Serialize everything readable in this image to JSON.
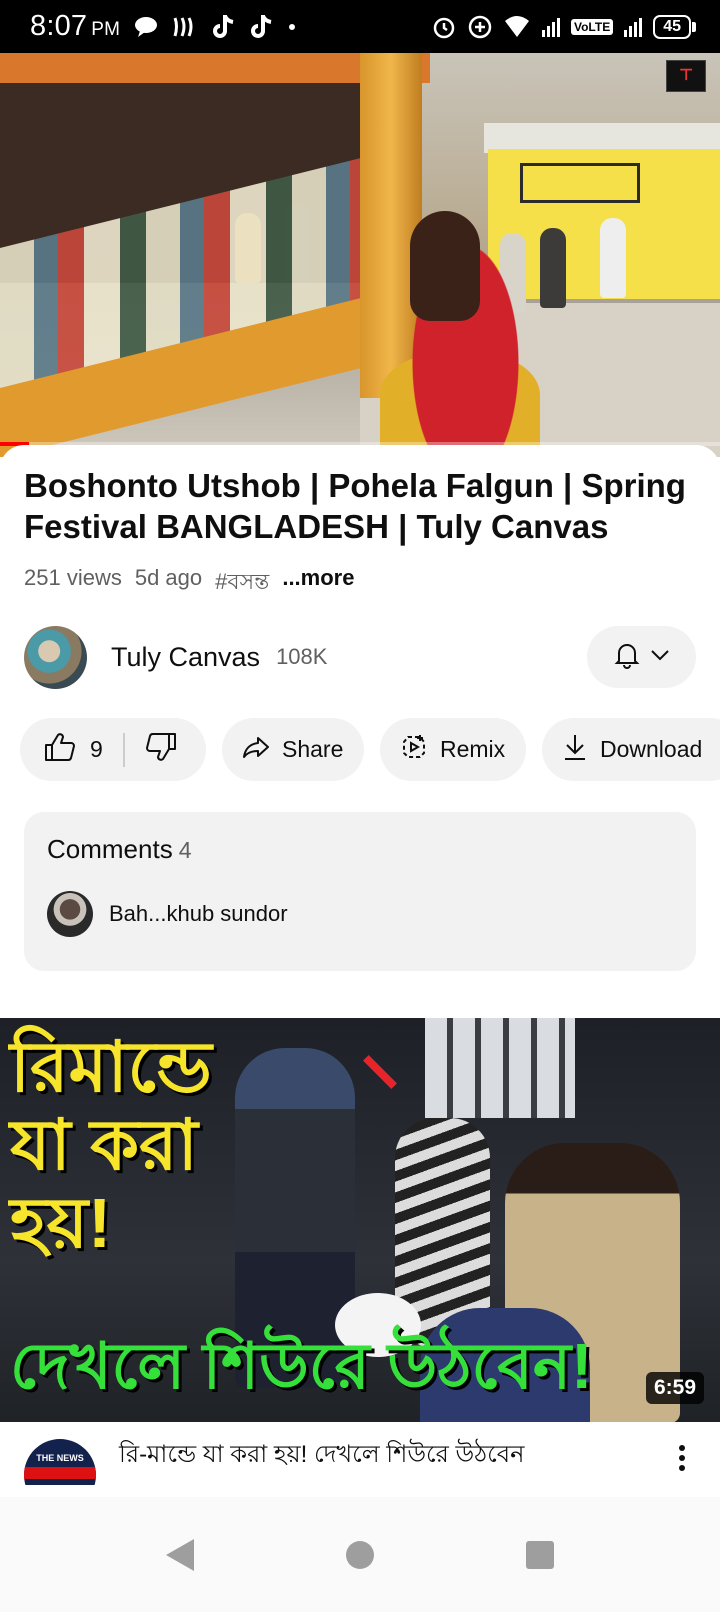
{
  "status_bar": {
    "time": "8:07",
    "ampm": "PM",
    "volte": "VoLTE",
    "battery": "45"
  },
  "player": {
    "progress_fraction": 0.04
  },
  "video": {
    "title": "Boshonto Utshob | Pohela Falgun | Spring Festival BANGLADESH | Tuly Canvas",
    "views": "251 views",
    "age": "5d ago",
    "hashtag": "#বসন্ত",
    "more_label": "...more"
  },
  "channel": {
    "name": "Tuly Canvas",
    "subscribers": "108K"
  },
  "actions": {
    "like_count": "9",
    "share_label": "Share",
    "remix_label": "Remix",
    "download_label": "Download"
  },
  "comments": {
    "heading": "Comments",
    "count": "4",
    "top_comment": "Bah...khub sundor"
  },
  "next_video": {
    "thumb_text_top": "রিমান্ডে যা করা হয়!",
    "thumb_text_bottom": "দেখলে শিউরে উঠবেন!",
    "duration": "6:59",
    "title": "রি-মান্ডে যা করা হয়! দেখলে শিউরে উঠবেন",
    "channel_avatar_text": "THE NEWS"
  },
  "colors": {
    "accent_red": "#ff0000",
    "pill_bg": "#f2f2f2",
    "text_secondary": "#606060"
  }
}
